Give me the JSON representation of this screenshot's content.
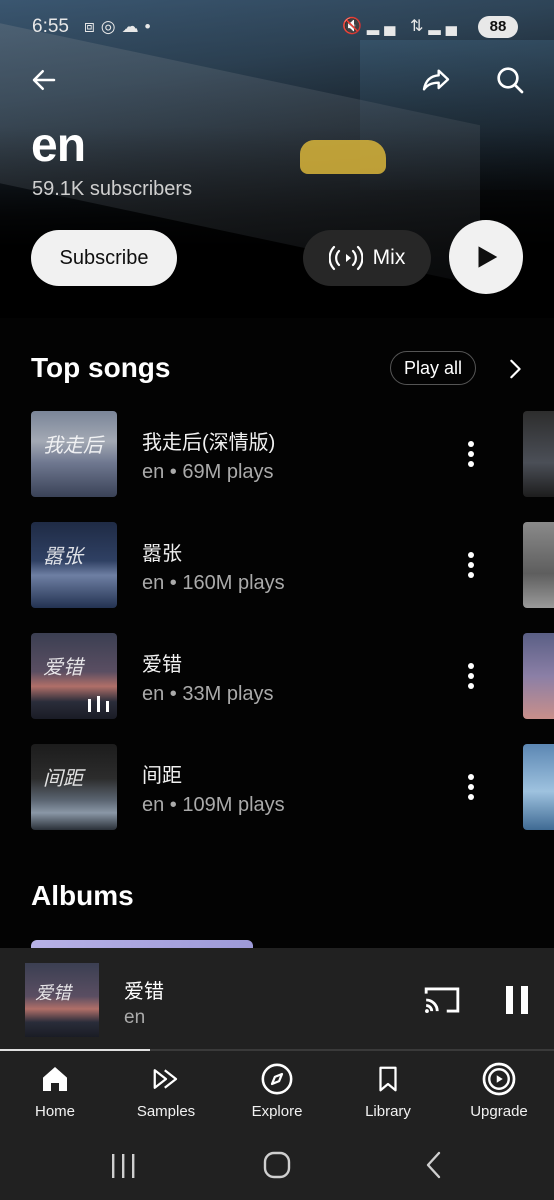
{
  "status_bar": {
    "time": "6:55",
    "battery": "88"
  },
  "header": {
    "artist_name": "en",
    "subscribers": "59.1K subscribers",
    "subscribe_label": "Subscribe",
    "mix_label": "Mix"
  },
  "top_songs": {
    "title": "Top songs",
    "play_all_label": "Play all",
    "songs": [
      {
        "title": "我走后(深情版)",
        "meta": "en • 69M plays",
        "art_text": "我走后"
      },
      {
        "title": "嚣张",
        "meta": "en • 160M plays",
        "art_text": "嚣张"
      },
      {
        "title": "爱错",
        "meta": "en • 33M plays",
        "art_text": "爱错"
      },
      {
        "title": "间距",
        "meta": "en • 109M plays",
        "art_text": "间距"
      }
    ]
  },
  "albums": {
    "title": "Albums"
  },
  "mini_player": {
    "title": "爱错",
    "artist": "en",
    "art_text": "爱错",
    "progress": 0.27
  },
  "bottom_nav": {
    "items": [
      {
        "label": "Home",
        "icon": "home-icon",
        "active": true
      },
      {
        "label": "Samples",
        "icon": "samples-icon",
        "active": false
      },
      {
        "label": "Explore",
        "icon": "explore-icon",
        "active": false
      },
      {
        "label": "Library",
        "icon": "library-icon",
        "active": false
      },
      {
        "label": "Upgrade",
        "icon": "upgrade-icon",
        "active": false
      }
    ]
  },
  "colors": {
    "background": "#030303",
    "surface": "#212121",
    "chip": "#272727",
    "text_secondary": "#aaaaaa"
  }
}
